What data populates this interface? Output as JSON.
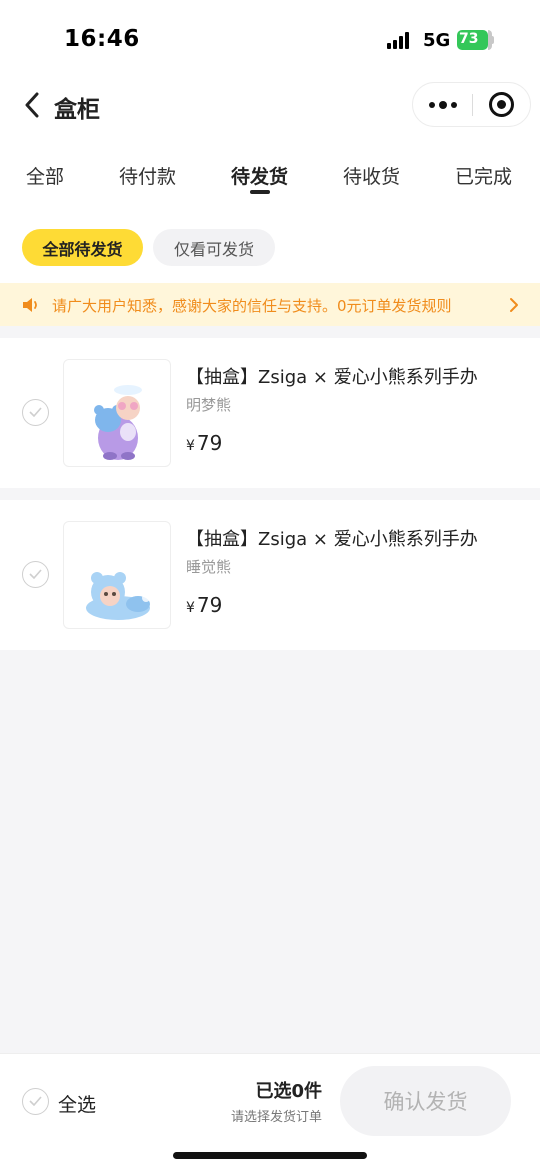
{
  "status_bar": {
    "time": "16:46",
    "network": "5G",
    "battery": "73"
  },
  "nav": {
    "title": "盒柜"
  },
  "tabs": [
    {
      "label": "全部",
      "active": false
    },
    {
      "label": "待付款",
      "active": false
    },
    {
      "label": "待发货",
      "active": true
    },
    {
      "label": "待收货",
      "active": false
    },
    {
      "label": "已完成",
      "active": false
    }
  ],
  "filters": {
    "all_pending": "全部待发货",
    "shippable_only": "仅看可发货"
  },
  "notice": {
    "text": "请广大用户知悉，感谢大家的信任与支持。0元订单发货规则"
  },
  "items": [
    {
      "title": "【抽盒】Zsiga × 爱心小熊系列手办",
      "variant": "明梦熊",
      "currency": "¥",
      "price": "79"
    },
    {
      "title": "【抽盒】Zsiga × 爱心小熊系列手办",
      "variant": "睡觉熊",
      "currency": "¥",
      "price": "79"
    }
  ],
  "bottom_bar": {
    "select_all": "全选",
    "selected_count": "已选0件",
    "hint": "请选择发货订单",
    "confirm": "确认发货"
  },
  "colors": {
    "accent_yellow": "#fedb35",
    "notice_bg": "#fff6da",
    "notice_text": "#f08c1c",
    "battery": "#34c759"
  }
}
